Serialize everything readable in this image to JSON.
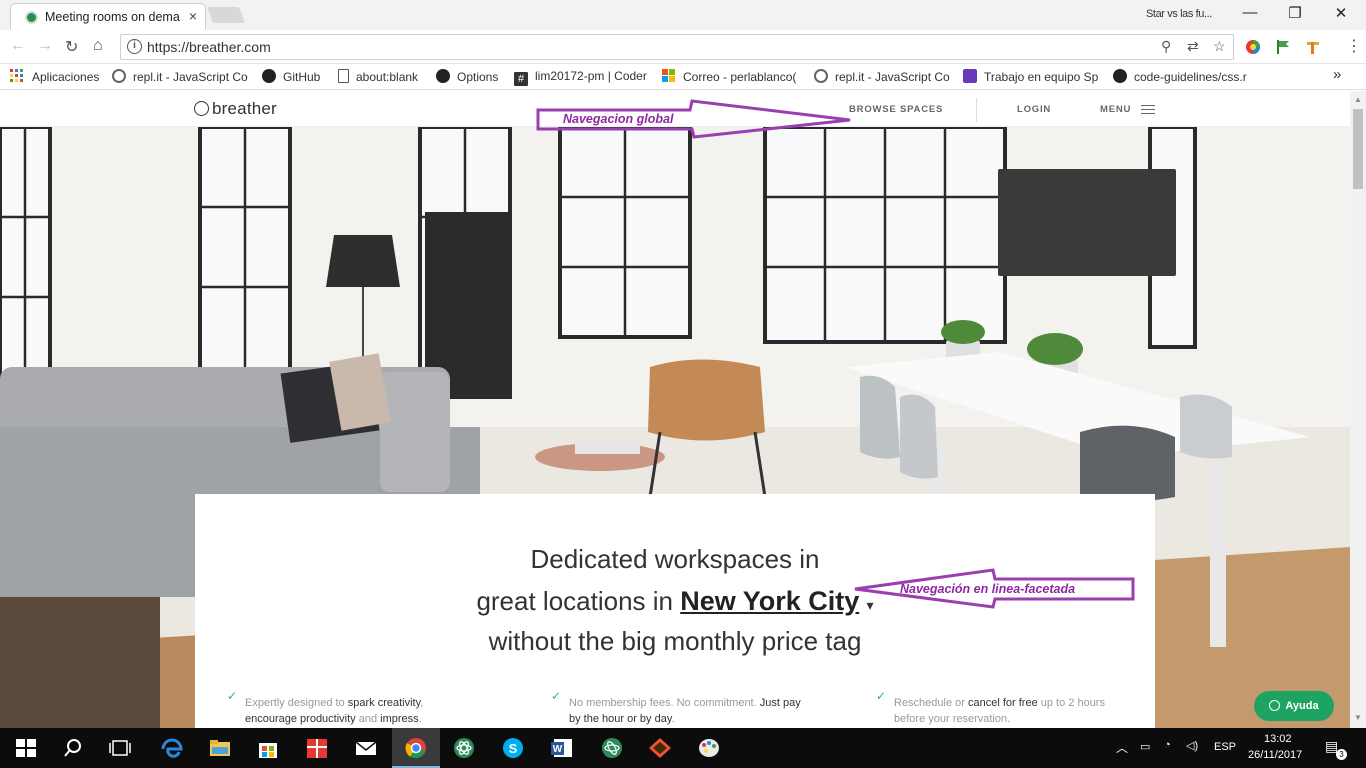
{
  "browser": {
    "tab_title": "Meeting rooms on dema",
    "tab_close": "×",
    "window_title": "Star vs las fu...",
    "url": "https://breather.com",
    "bookmarks": [
      {
        "label": "Aplicaciones"
      },
      {
        "label": "repl.it - JavaScript Co"
      },
      {
        "label": "GitHub"
      },
      {
        "label": "about:blank"
      },
      {
        "label": "Options"
      },
      {
        "label": "lim20172-pm | Coder"
      },
      {
        "label": "Correo - perlablanco("
      },
      {
        "label": "repl.it - JavaScript Co"
      },
      {
        "label": "Trabajo en equipo Sp"
      },
      {
        "label": "code-guidelines/css.r"
      }
    ],
    "bookmarks_more": "»"
  },
  "site": {
    "logo_text": "breather",
    "nav": {
      "browse": "BROWSE SPACES",
      "login": "LOGIN",
      "menu": "MENU"
    },
    "headline": {
      "line1": "Dedicated workspaces in",
      "line2_prefix": "great locations in ",
      "city": "New York City",
      "caret": "▾",
      "line3": "without the big monthly price tag"
    },
    "features": [
      {
        "a": "Expertly designed to ",
        "b": "spark creativity",
        "c": ",",
        "d": "encourage productivity",
        "e": " and ",
        "f": "impress",
        "g": "."
      },
      {
        "a": "No membership fees. No commitment. ",
        "b": "Just pay",
        "d": "by the hour or by day",
        "g": "."
      },
      {
        "a": "Reschedule or ",
        "b": "cancel for free",
        "c": " up to 2 hours",
        "d": "before your reservation."
      }
    ],
    "check": "✓",
    "help_button": "Ayuda"
  },
  "annotations": {
    "global_nav": "Navegacion global",
    "faceted_nav": "Navegación en linea-facetada"
  },
  "taskbar": {
    "lang": "ESP",
    "time": "13:02",
    "date": "26/11/2017",
    "notif_count": "3"
  },
  "colors": {
    "accent_green": "#1da462",
    "annotation_purple": "#8e2aa0"
  }
}
